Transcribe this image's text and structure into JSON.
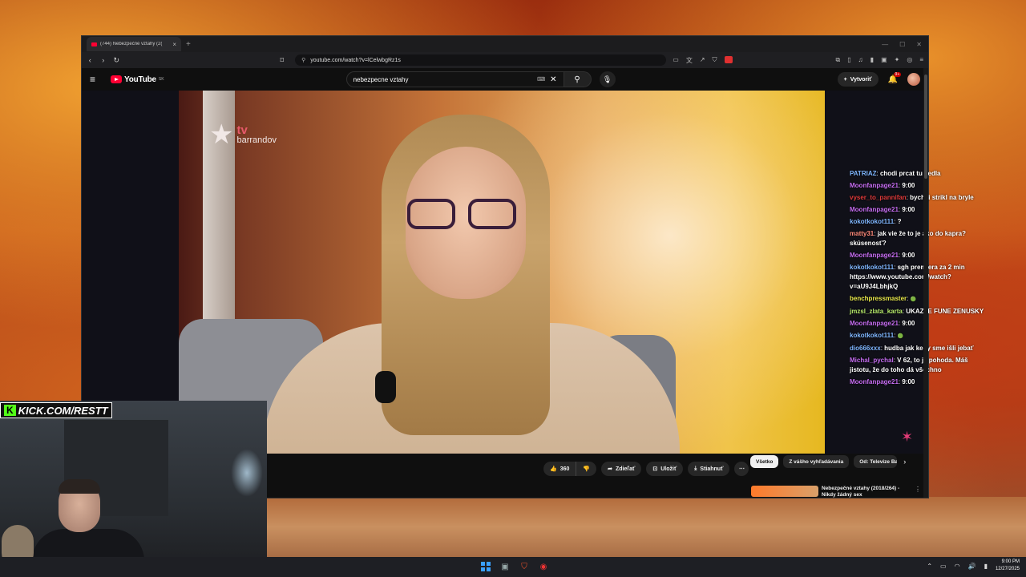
{
  "browser": {
    "tab_title": "(744) Nebezpečné vztahy (2(",
    "url": "youtube.com/watch?v=lCelwbgRz1s",
    "extension_badge": "8"
  },
  "youtube": {
    "logo_text": "YouTube",
    "country_code": "SK",
    "search_query": "nebezpecne vztahy",
    "create_label": "Vytvoriť",
    "notifications": "9+"
  },
  "video": {
    "channel_logo_tv": "tv",
    "channel_logo_name": "barrandov"
  },
  "chat": [
    {
      "user": "PATRIAZ",
      "color": "#7fb6ff",
      "text": "chodi prcat tu vedla"
    },
    {
      "user": "Moonfanpage21",
      "color": "#c56cf0",
      "text": "9:00"
    },
    {
      "user": "vyser_to_pannifan",
      "color": "#e03a3a",
      "text": "bych ji strikl na bryle"
    },
    {
      "user": "Moonfanpage21",
      "color": "#c56cf0",
      "text": "9:00"
    },
    {
      "user": "kokotkokot111",
      "color": "#7fb6ff",
      "text": "?"
    },
    {
      "user": "matty31",
      "color": "#ff8a7a",
      "text": "jak vie že to je ako do kapra? skúsenosť?"
    },
    {
      "user": "Moonfanpage21",
      "color": "#c56cf0",
      "text": "9:00"
    },
    {
      "user": "kokotkokot111",
      "color": "#7fb6ff",
      "text": "sgh premiera za 2 min https://www.youtube.com/watch?v=aU9J4LbhjkQ"
    },
    {
      "user": "benchpressmaster",
      "color": "#e8e84a",
      "text": ""
    },
    {
      "user": "jmzsl_zlata_karta",
      "color": "#b5e86a",
      "text": "UKAZTE FUNE ZENUSKY"
    },
    {
      "user": "Moonfanpage21",
      "color": "#c56cf0",
      "text": "9:00"
    },
    {
      "user": "kokotkokot111",
      "color": "#7fb6ff",
      "text": ""
    },
    {
      "user": "dio666xxx",
      "color": "#7fb6ff",
      "text": "hudba jak keby sme išli jebať"
    },
    {
      "user": "Michal_pychal",
      "color": "#c56cf0",
      "text": "V 62, to je pohoda. Máš jistotu, že do toho dá všechno"
    },
    {
      "user": "Moonfanpage21",
      "color": "#c56cf0",
      "text": "9:00"
    }
  ],
  "actions": {
    "likes": "360",
    "share": "Zdieľať",
    "save": "Uložiť",
    "download": "Stiahnuť"
  },
  "chips": [
    "Všetko",
    "Z vášho vyhľadávania",
    "Od: Televize Ba"
  ],
  "recommended": {
    "title": "Nebezpečné vztahy (2018/264) - Nikdy žádný sex"
  },
  "webcam": {
    "kick_label": "KICK.COM/RESTT"
  },
  "taskbar": {
    "time": "9:00 PM",
    "date": "12/27/2025"
  }
}
